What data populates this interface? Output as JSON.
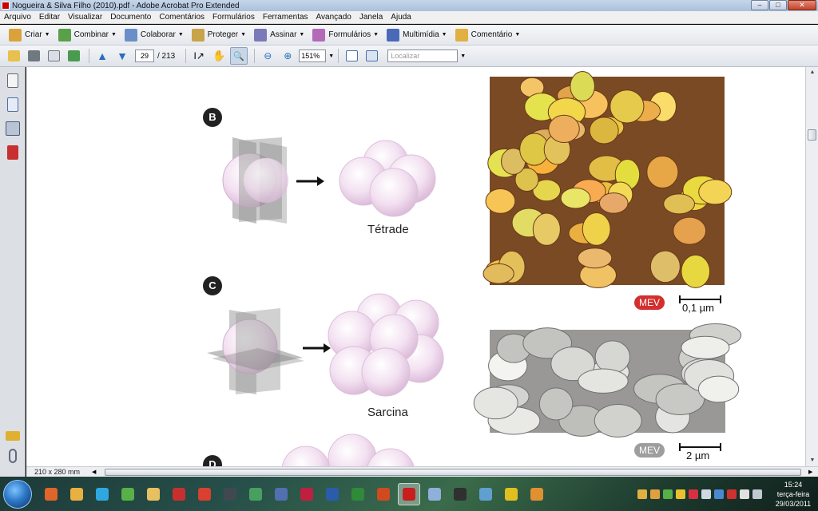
{
  "window": {
    "title": "Nogueira & Silva Filho (2010).pdf - Adobe Acrobat Pro Extended",
    "controls": [
      "–",
      "□",
      "✕"
    ]
  },
  "menubar": [
    "Arquivo",
    "Editar",
    "Visualizar",
    "Documento",
    "Comentários",
    "Formulários",
    "Ferramentas",
    "Avançado",
    "Janela",
    "Ajuda"
  ],
  "toolbar1": [
    {
      "label": "Criar",
      "icon": "create-icon",
      "color": "#d9a23a"
    },
    {
      "label": "Combinar",
      "icon": "combine-icon",
      "color": "#5aa04a"
    },
    {
      "label": "Colaborar",
      "icon": "collaborate-icon",
      "color": "#6a8fc8"
    },
    {
      "label": "Proteger",
      "icon": "lock-icon",
      "color": "#c9a34a"
    },
    {
      "label": "Assinar",
      "icon": "pen-icon",
      "color": "#7a7ab8"
    },
    {
      "label": "Formulários",
      "icon": "forms-icon",
      "color": "#b36ab8"
    },
    {
      "label": "Multimídia",
      "icon": "multimedia-icon",
      "color": "#4a6ab8"
    },
    {
      "label": "Comentário",
      "icon": "comment-icon",
      "color": "#e0b040"
    }
  ],
  "toolbar2": {
    "page_current": "29",
    "page_total": "/ 213",
    "zoom": "151%",
    "search_placeholder": "Localizar"
  },
  "document": {
    "figure_b": {
      "badge": "B",
      "caption": "Tétrade",
      "mev": "MEV",
      "scale": "0,1 µm",
      "mev_color": "#d32f2f"
    },
    "figure_c": {
      "badge": "C",
      "caption": "Sarcina",
      "mev": "MEV",
      "scale": "2 µm",
      "mev_color": "#9e9e9e"
    },
    "figure_d": {
      "badge": "D"
    }
  },
  "status": {
    "page_size": "210 x 280 mm"
  },
  "taskbar": {
    "apps": [
      {
        "name": "firefox",
        "color": "#e0652a"
      },
      {
        "name": "messenger",
        "color": "#e8b040"
      },
      {
        "name": "skype",
        "color": "#2fa8e0"
      },
      {
        "name": "utorrent",
        "color": "#58b048"
      },
      {
        "name": "explorer",
        "color": "#e8c060"
      },
      {
        "name": "app-red",
        "color": "#c83030"
      },
      {
        "name": "app-chrome",
        "color": "#d84030"
      },
      {
        "name": "app-dark",
        "color": "#404850"
      },
      {
        "name": "app-green",
        "color": "#48a060"
      },
      {
        "name": "app-blue",
        "color": "#5070b0"
      },
      {
        "name": "app-m",
        "color": "#c02040"
      },
      {
        "name": "word",
        "color": "#2b5caa"
      },
      {
        "name": "excel",
        "color": "#2f8a3a"
      },
      {
        "name": "powerpoint",
        "color": "#d04a20"
      },
      {
        "name": "acrobat",
        "color": "#c81e1e",
        "active": true
      },
      {
        "name": "notepad",
        "color": "#8fb0d8"
      },
      {
        "name": "terminal",
        "color": "#303030"
      },
      {
        "name": "screen",
        "color": "#60a0d0"
      },
      {
        "name": "dollar",
        "color": "#e0c020"
      },
      {
        "name": "media",
        "color": "#e09030"
      }
    ],
    "clock_time": "15:24",
    "clock_day": "terça-feira",
    "clock_date": "29/03/2011"
  }
}
